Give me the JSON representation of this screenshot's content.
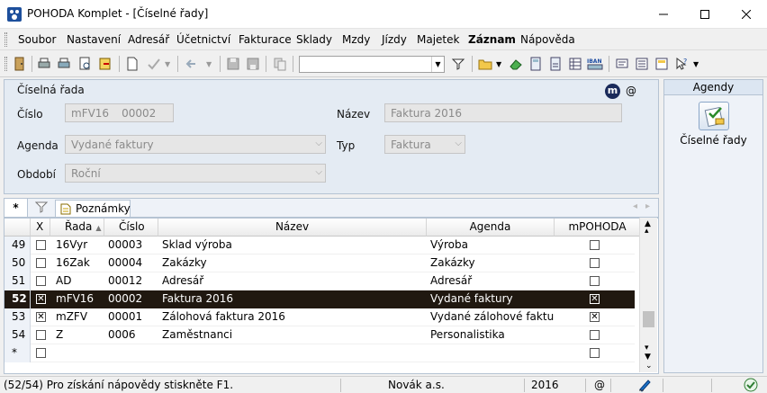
{
  "window": {
    "title": "POHODA Komplet - [Číselné řady]",
    "controls": [
      "minimize",
      "maximize",
      "close"
    ]
  },
  "menu": [
    "Soubor",
    "Nastavení",
    "Adresář",
    "Účetnictví",
    "Fakturace",
    "Sklady",
    "Mzdy",
    "Jízdy",
    "Majetek",
    "Záznam",
    "Nápověda"
  ],
  "toolbar": {
    "combo_value": ""
  },
  "form": {
    "section_title": "Číselná řada",
    "badge_m": "m",
    "badge_at": "@",
    "cislo_label": "Číslo",
    "cislo_prefix": "mFV16",
    "cislo_number": "00002",
    "nazev_label": "Název",
    "nazev_value": "Faktura 2016",
    "agenda_label": "Agenda",
    "agenda_value": "Vydané faktury",
    "typ_label": "Typ",
    "typ_value": "Faktura",
    "obdobi_label": "Období",
    "obdobi_value": "Roční"
  },
  "agendy": {
    "header": "Agendy",
    "item_label": "Číselné řady"
  },
  "tabs": {
    "star": "*",
    "notes": "Poznámky"
  },
  "table": {
    "columns": [
      "X",
      "Řada",
      "Číslo",
      "Název",
      "Agenda",
      "mPOHODA"
    ],
    "rows": [
      {
        "rownum": "49",
        "x": false,
        "rada": "16Vyr",
        "cislo": "00003",
        "nazev": "Sklad výroba",
        "agenda": "Výroba",
        "mpohoda": false
      },
      {
        "rownum": "50",
        "x": false,
        "rada": "16Zak",
        "cislo": "00004",
        "nazev": "Zakázky",
        "agenda": "Zakázky",
        "mpohoda": false
      },
      {
        "rownum": "51",
        "x": false,
        "rada": "AD",
        "cislo": "00012",
        "nazev": "Adresář",
        "agenda": "Adresář",
        "mpohoda": false
      },
      {
        "rownum": "52",
        "x": true,
        "rada": "mFV16",
        "cislo": "00002",
        "nazev": "Faktura 2016",
        "agenda": "Vydané faktury",
        "mpohoda": true,
        "selected": true
      },
      {
        "rownum": "53",
        "x": true,
        "rada": "mZFV",
        "cislo": "00001",
        "nazev": "Zálohová faktura 2016",
        "agenda": "Vydané zálohové faktury",
        "mpohoda": true
      },
      {
        "rownum": "54",
        "x": false,
        "rada": "Z",
        "cislo": "0006",
        "nazev": "Zaměstnanci",
        "agenda": "Personalistika",
        "mpohoda": false
      },
      {
        "rownum": "*",
        "x": false,
        "rada": "",
        "cislo": "",
        "nazev": "",
        "agenda": "",
        "mpohoda": false
      }
    ]
  },
  "status": {
    "help": "(52/54) Pro získání nápovědy stiskněte F1.",
    "company": "Novák a.s.",
    "year": "2016",
    "at": "@"
  },
  "colors": {
    "selected_row": "#201810",
    "panel": "#e4ebf3",
    "accent": "#1a73c9"
  }
}
